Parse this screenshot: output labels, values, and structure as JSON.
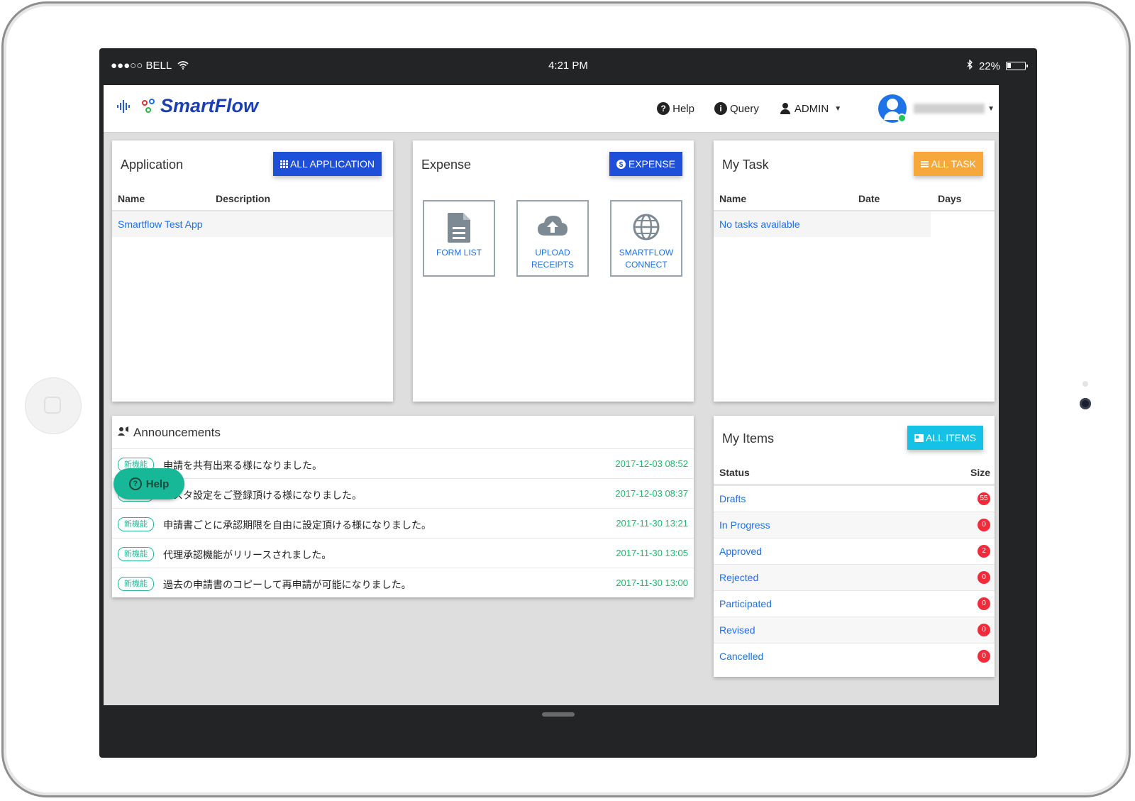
{
  "status_bar": {
    "carrier": "●●●○○ BELL",
    "time": "4:21 PM",
    "battery": "22%"
  },
  "navbar": {
    "logo_text": "SmartFlow",
    "help_label": "Help",
    "query_label": "Query",
    "admin_label": "ADMIN"
  },
  "application_card": {
    "title": "Application",
    "button_label": "ALL APPLICATION",
    "col_name": "Name",
    "col_description": "Description",
    "rows": [
      {
        "name": "Smartflow Test App",
        "description": ""
      }
    ]
  },
  "expense_card": {
    "title": "Expense",
    "button_label": "EXPENSE",
    "tiles": [
      {
        "label_line1": "FORM LIST",
        "label_line2": ""
      },
      {
        "label_line1": "UPLOAD",
        "label_line2": "RECEIPTS"
      },
      {
        "label_line1": "SMARTFLOW",
        "label_line2": "CONNECT"
      }
    ]
  },
  "task_card": {
    "title": "My Task",
    "button_label": "ALL TASK",
    "col_name": "Name",
    "col_date": "Date",
    "col_days": "Days",
    "empty_text": "No tasks available"
  },
  "announcements": {
    "title": "Announcements",
    "items": [
      {
        "badge": "新機能",
        "text": "申請を共有出来る様になりました。",
        "date": "2017-12-03 08:52"
      },
      {
        "badge": "新機能",
        "text": "マスタ設定をご登録頂ける様になりました。",
        "date": "2017-12-03 08:37"
      },
      {
        "badge": "新機能",
        "text": "申請書ごとに承認期限を自由に設定頂ける様になりました。",
        "date": "2017-11-30 13:21"
      },
      {
        "badge": "新機能",
        "text": "代理承認機能がリリースされました。",
        "date": "2017-11-30 13:05"
      },
      {
        "badge": "新機能",
        "text": "過去の申請書のコピーして再申請が可能になりました。",
        "date": "2017-11-30 13:00"
      }
    ]
  },
  "help_fab": {
    "label": "Help"
  },
  "items_card": {
    "title": "My Items",
    "button_label": "ALL ITEMS",
    "col_status": "Status",
    "col_size": "Size",
    "rows": [
      {
        "status": "Drafts",
        "size": "55"
      },
      {
        "status": "In Progress",
        "size": "0"
      },
      {
        "status": "Approved",
        "size": "2"
      },
      {
        "status": "Rejected",
        "size": "0"
      },
      {
        "status": "Participated",
        "size": "0"
      },
      {
        "status": "Revised",
        "size": "0"
      },
      {
        "status": "Cancelled",
        "size": "0"
      }
    ]
  },
  "colors": {
    "primary_blue": "#1e4fd8",
    "accent_orange": "#f7a83a",
    "accent_cyan": "#16c1e6",
    "badge_green": "#26b89a",
    "date_green": "#19b86b",
    "count_red": "#f22b3b"
  },
  "icons": [
    "wifi-icon",
    "bluetooth-icon",
    "battery-icon",
    "help-icon",
    "info-icon",
    "user-icon",
    "grid-icon",
    "dollar-icon",
    "list-icon",
    "document-icon",
    "cloud-upload-icon",
    "globe-icon",
    "megaphone-icon",
    "folder-icon"
  ]
}
